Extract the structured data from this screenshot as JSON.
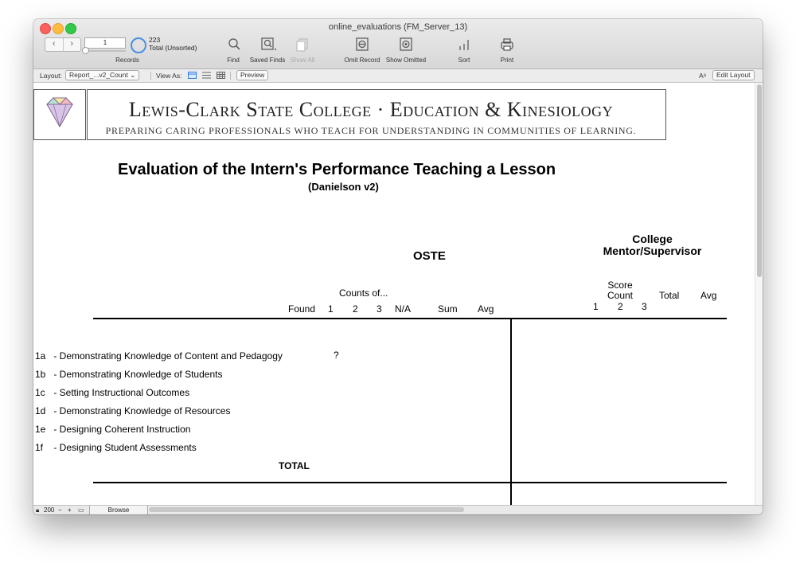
{
  "window": {
    "title": "online_evaluations (FM_Server_13)"
  },
  "toolbar": {
    "record_number": "1",
    "record_count": "223",
    "record_status": "Total (Unsorted)",
    "records_label": "Records",
    "find_label": "Find",
    "saved_finds_label": "Saved Finds",
    "show_all_label": "Show All",
    "omit_record_label": "Omit Record",
    "show_omitted_label": "Show Omitted",
    "sort_label": "Sort",
    "print_label": "Print"
  },
  "layout_bar": {
    "layout_label": "Layout:",
    "layout_value": "Report_...v2_Count",
    "view_as_label": "View As:",
    "preview_label": "Preview",
    "font_size_glyph": "Aᵃ",
    "edit_layout_label": "Edit Layout"
  },
  "report": {
    "banner_title": "Lewis-Clark State College · Education & Kinesiology",
    "banner_subtitle": "Preparing caring professionals who teach for understanding in communities of learning.",
    "title": "Evaluation of the Intern's Performance Teaching a Lesson",
    "subtitle": "(Danielson v2)",
    "oste_header": "OSTE",
    "college_header_1": "College",
    "college_header_2": "Mentor/Supervisor",
    "counts_of": "Counts of...",
    "col_found": "Found",
    "col_1": "1",
    "col_2": "2",
    "col_3": "3",
    "col_na": "N/A",
    "col_sum": "Sum",
    "col_avg": "Avg",
    "score_count_1": "Score",
    "score_count_2": "Count",
    "r_col_1": "1",
    "r_col_2": "2",
    "r_col_3": "3",
    "r_total": "Total",
    "r_avg": "Avg",
    "rows": [
      {
        "code": "1a",
        "label": "- Demonstrating Knowledge of Content and Pedagogy",
        "found": "?"
      },
      {
        "code": "1b",
        "label": "- Demonstrating Knowledge of Students",
        "found": ""
      },
      {
        "code": "1c",
        "label": "- Setting Instructional Outcomes",
        "found": ""
      },
      {
        "code": "1d",
        "label": "- Demonstrating Knowledge of Resources",
        "found": ""
      },
      {
        "code": "1e",
        "label": "- Designing Coherent Instruction",
        "found": ""
      },
      {
        "code": "1f",
        "label": "- Designing Student Assessments",
        "found": ""
      }
    ],
    "total_label": "TOTAL"
  },
  "status_bar": {
    "zoom": "200",
    "mode": "Browse"
  }
}
